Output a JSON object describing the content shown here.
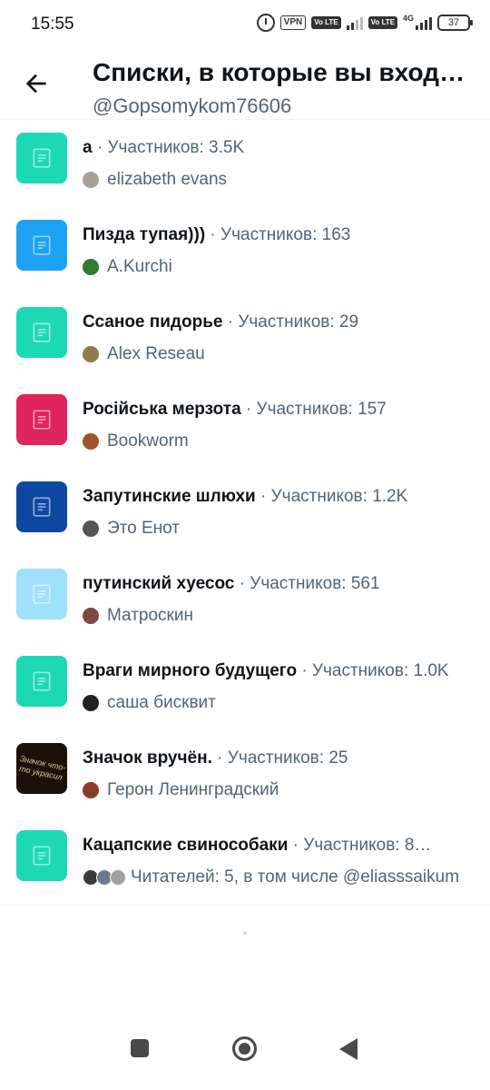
{
  "status_bar": {
    "time": "15:55",
    "vpn": "VPN",
    "lte1": "Vo LTE",
    "lte2": "Vo LTE",
    "net": "4G",
    "battery": "37"
  },
  "header": {
    "title": "Списки, в которые вы входите",
    "username": "@Gopsomykom76606"
  },
  "lists": [
    {
      "name": "а",
      "meta": " · Участников: 3.5K",
      "owner": "elizabeth evans",
      "icon_color": "#1dd8b5",
      "avatar_color": "#a8a19a"
    },
    {
      "name": "Пизда тупая)))",
      "meta": " · Участников: 163",
      "owner": "A.Kurchi",
      "icon_color": "#1da1f2",
      "avatar_color": "#2e7d32"
    },
    {
      "name": "Ссаное пидорье",
      "meta": " · Участников: 29",
      "owner": "Alex Reseau",
      "icon_color": "#1dd8b5",
      "avatar_color": "#8d7a4e"
    },
    {
      "name": "Російська мерзота",
      "meta": " · Участников: 157",
      "owner": "Bookworm",
      "icon_color": "#e0245e",
      "avatar_color": "#a0522d"
    },
    {
      "name": "Запутинские шлюхи",
      "meta": " · Участников: 1.2K",
      "owner": "Это Енот",
      "icon_color": "#0d47a1",
      "avatar_color": "#555555"
    },
    {
      "name": "путинский хуесос",
      "meta": " · Участников: 561",
      "owner": "Матроскин",
      "icon_color": "#9fe0fb",
      "avatar_color": "#7a4a3a"
    },
    {
      "name": "Враги мирного будущего",
      "meta": " · Участников: 1.0K",
      "owner": "саша бисквит",
      "icon_color": "#1dd8b5",
      "avatar_color": "#222222"
    },
    {
      "name": "Значок вручён.",
      "meta": " · Участников: 25",
      "owner": "Герон Ленинградский",
      "icon_color": "#1a1206",
      "avatar_color": "#8a3a2a",
      "badge_text": "Значок что-то украсил"
    },
    {
      "name": "Кацапские свинособаки",
      "meta": " · Участников: 8…",
      "owner": "Читателей: 5, в том числе @eliasssaikum",
      "icon_color": "#1dd8b5",
      "avatar_color": "#3a3a3a",
      "stack_colors": [
        "#3a3a3a",
        "#6b7a8f",
        "#a0a0a0"
      ]
    }
  ],
  "icons": {
    "back": "arrow-left-icon",
    "list": "list-document-icon"
  }
}
